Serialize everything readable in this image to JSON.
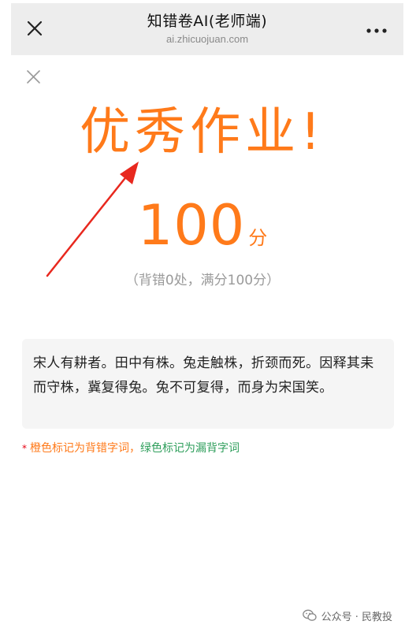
{
  "browser": {
    "title": "知错卷AI(老师端)",
    "url": "ai.zhicuojuan.com",
    "close_icon": "close-icon",
    "more_icon": "more-icon"
  },
  "result": {
    "headline": "优秀作业!",
    "score_value": "100",
    "score_unit": "分",
    "score_detail": "（背错0处，满分100分）"
  },
  "passage": {
    "text": "宋人有耕者。田中有株。兔走触株，折颈而死。因释其耒而守株，冀复得兔。兔不可复得，而身为宋国笑。"
  },
  "legend": {
    "star": "*",
    "orange_text": "橙色标记为背错字词，",
    "green_text": "绿色标记为漏背字词"
  },
  "footer": {
    "text": "公众号 · 民教投",
    "icon": "wechat-icon"
  },
  "colors": {
    "accent_orange": "#ff7a1a",
    "legend_green": "#2e9e5b",
    "arrow_red": "#e8281e"
  }
}
